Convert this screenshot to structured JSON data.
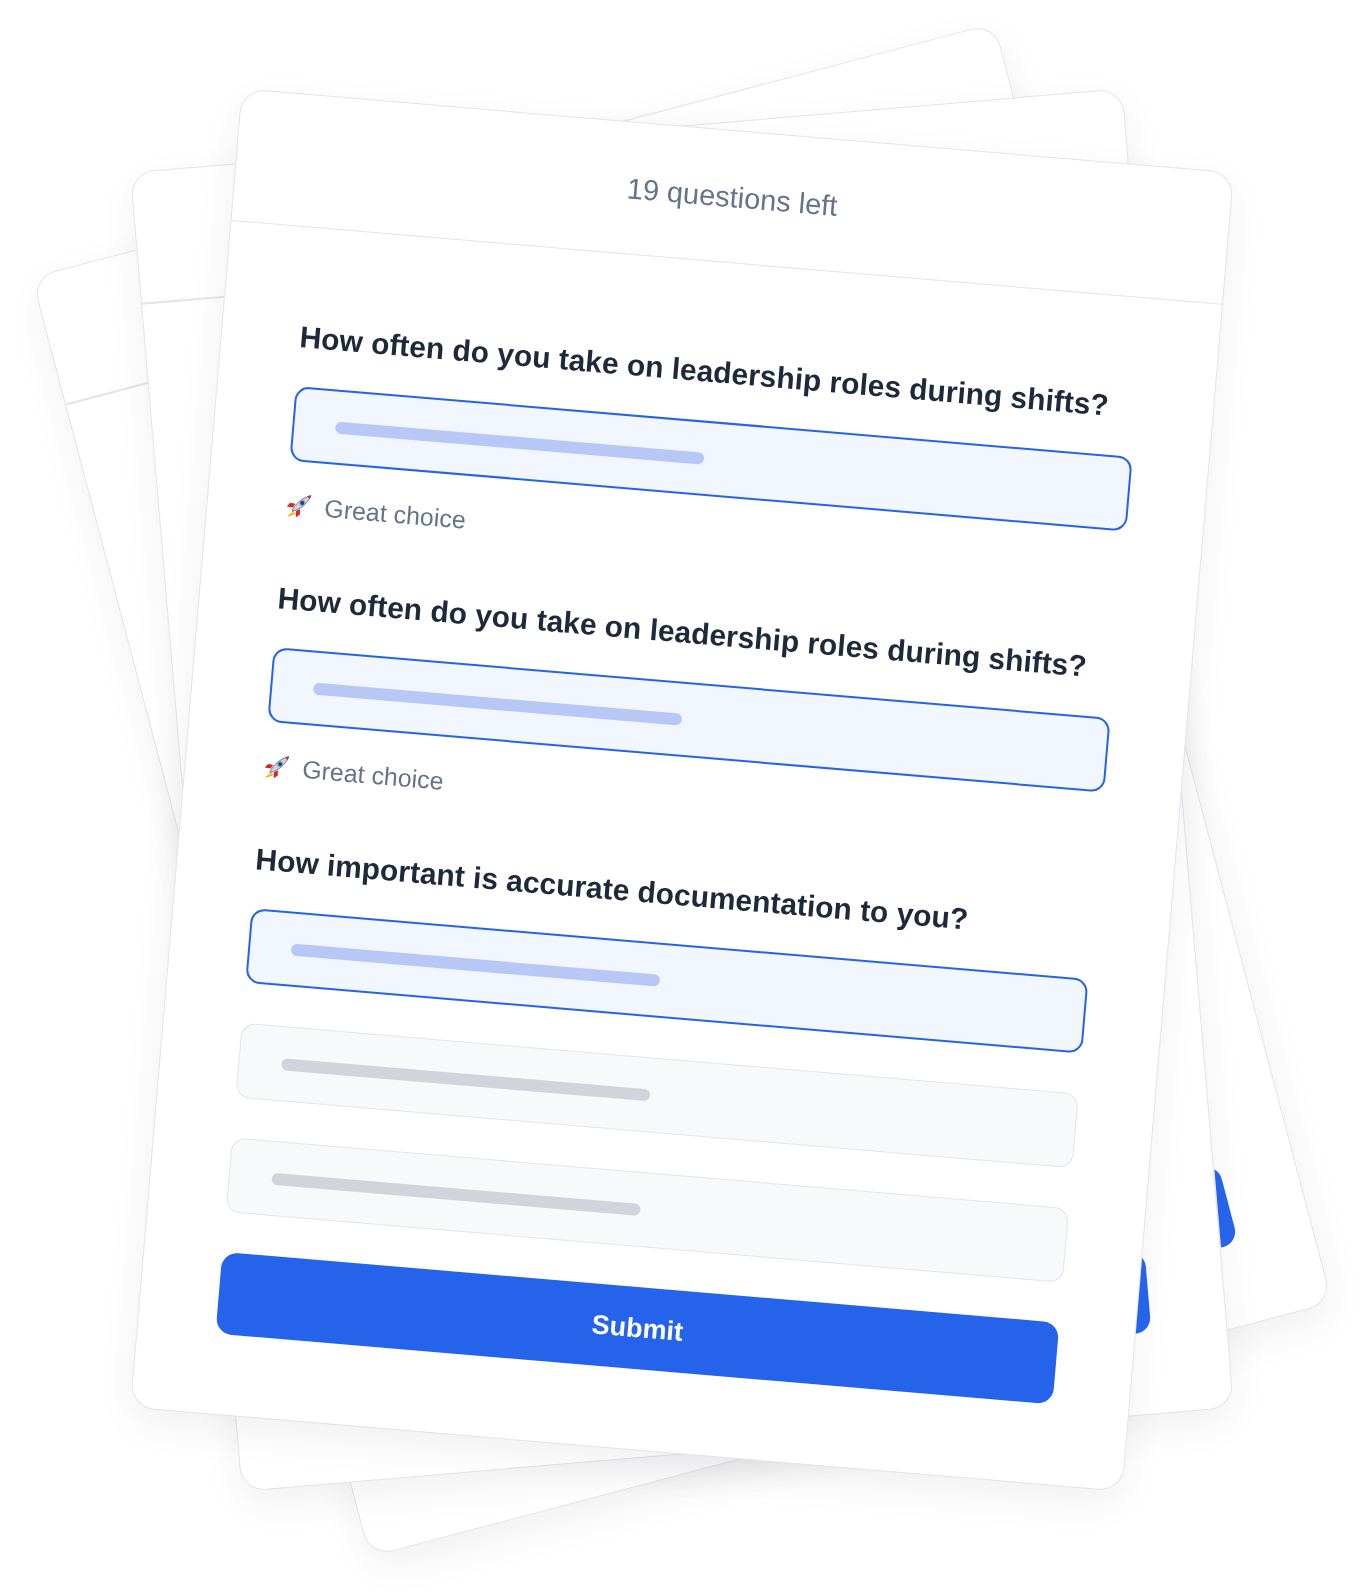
{
  "progress": {
    "text": "19 questions left"
  },
  "questions": [
    {
      "title": "How often do you take on leadership roles during shifts?",
      "options": [
        {
          "selected": true
        }
      ],
      "feedback": "Great choice"
    },
    {
      "title": "How often do you take on leadership roles during shifts?",
      "options": [
        {
          "selected": true
        }
      ],
      "feedback": "Great choice"
    },
    {
      "title": "How important is accurate documentation to you?",
      "options": [
        {
          "selected": true
        },
        {
          "selected": false
        },
        {
          "selected": false
        }
      ]
    }
  ],
  "submit_button": {
    "label": "Submit"
  }
}
